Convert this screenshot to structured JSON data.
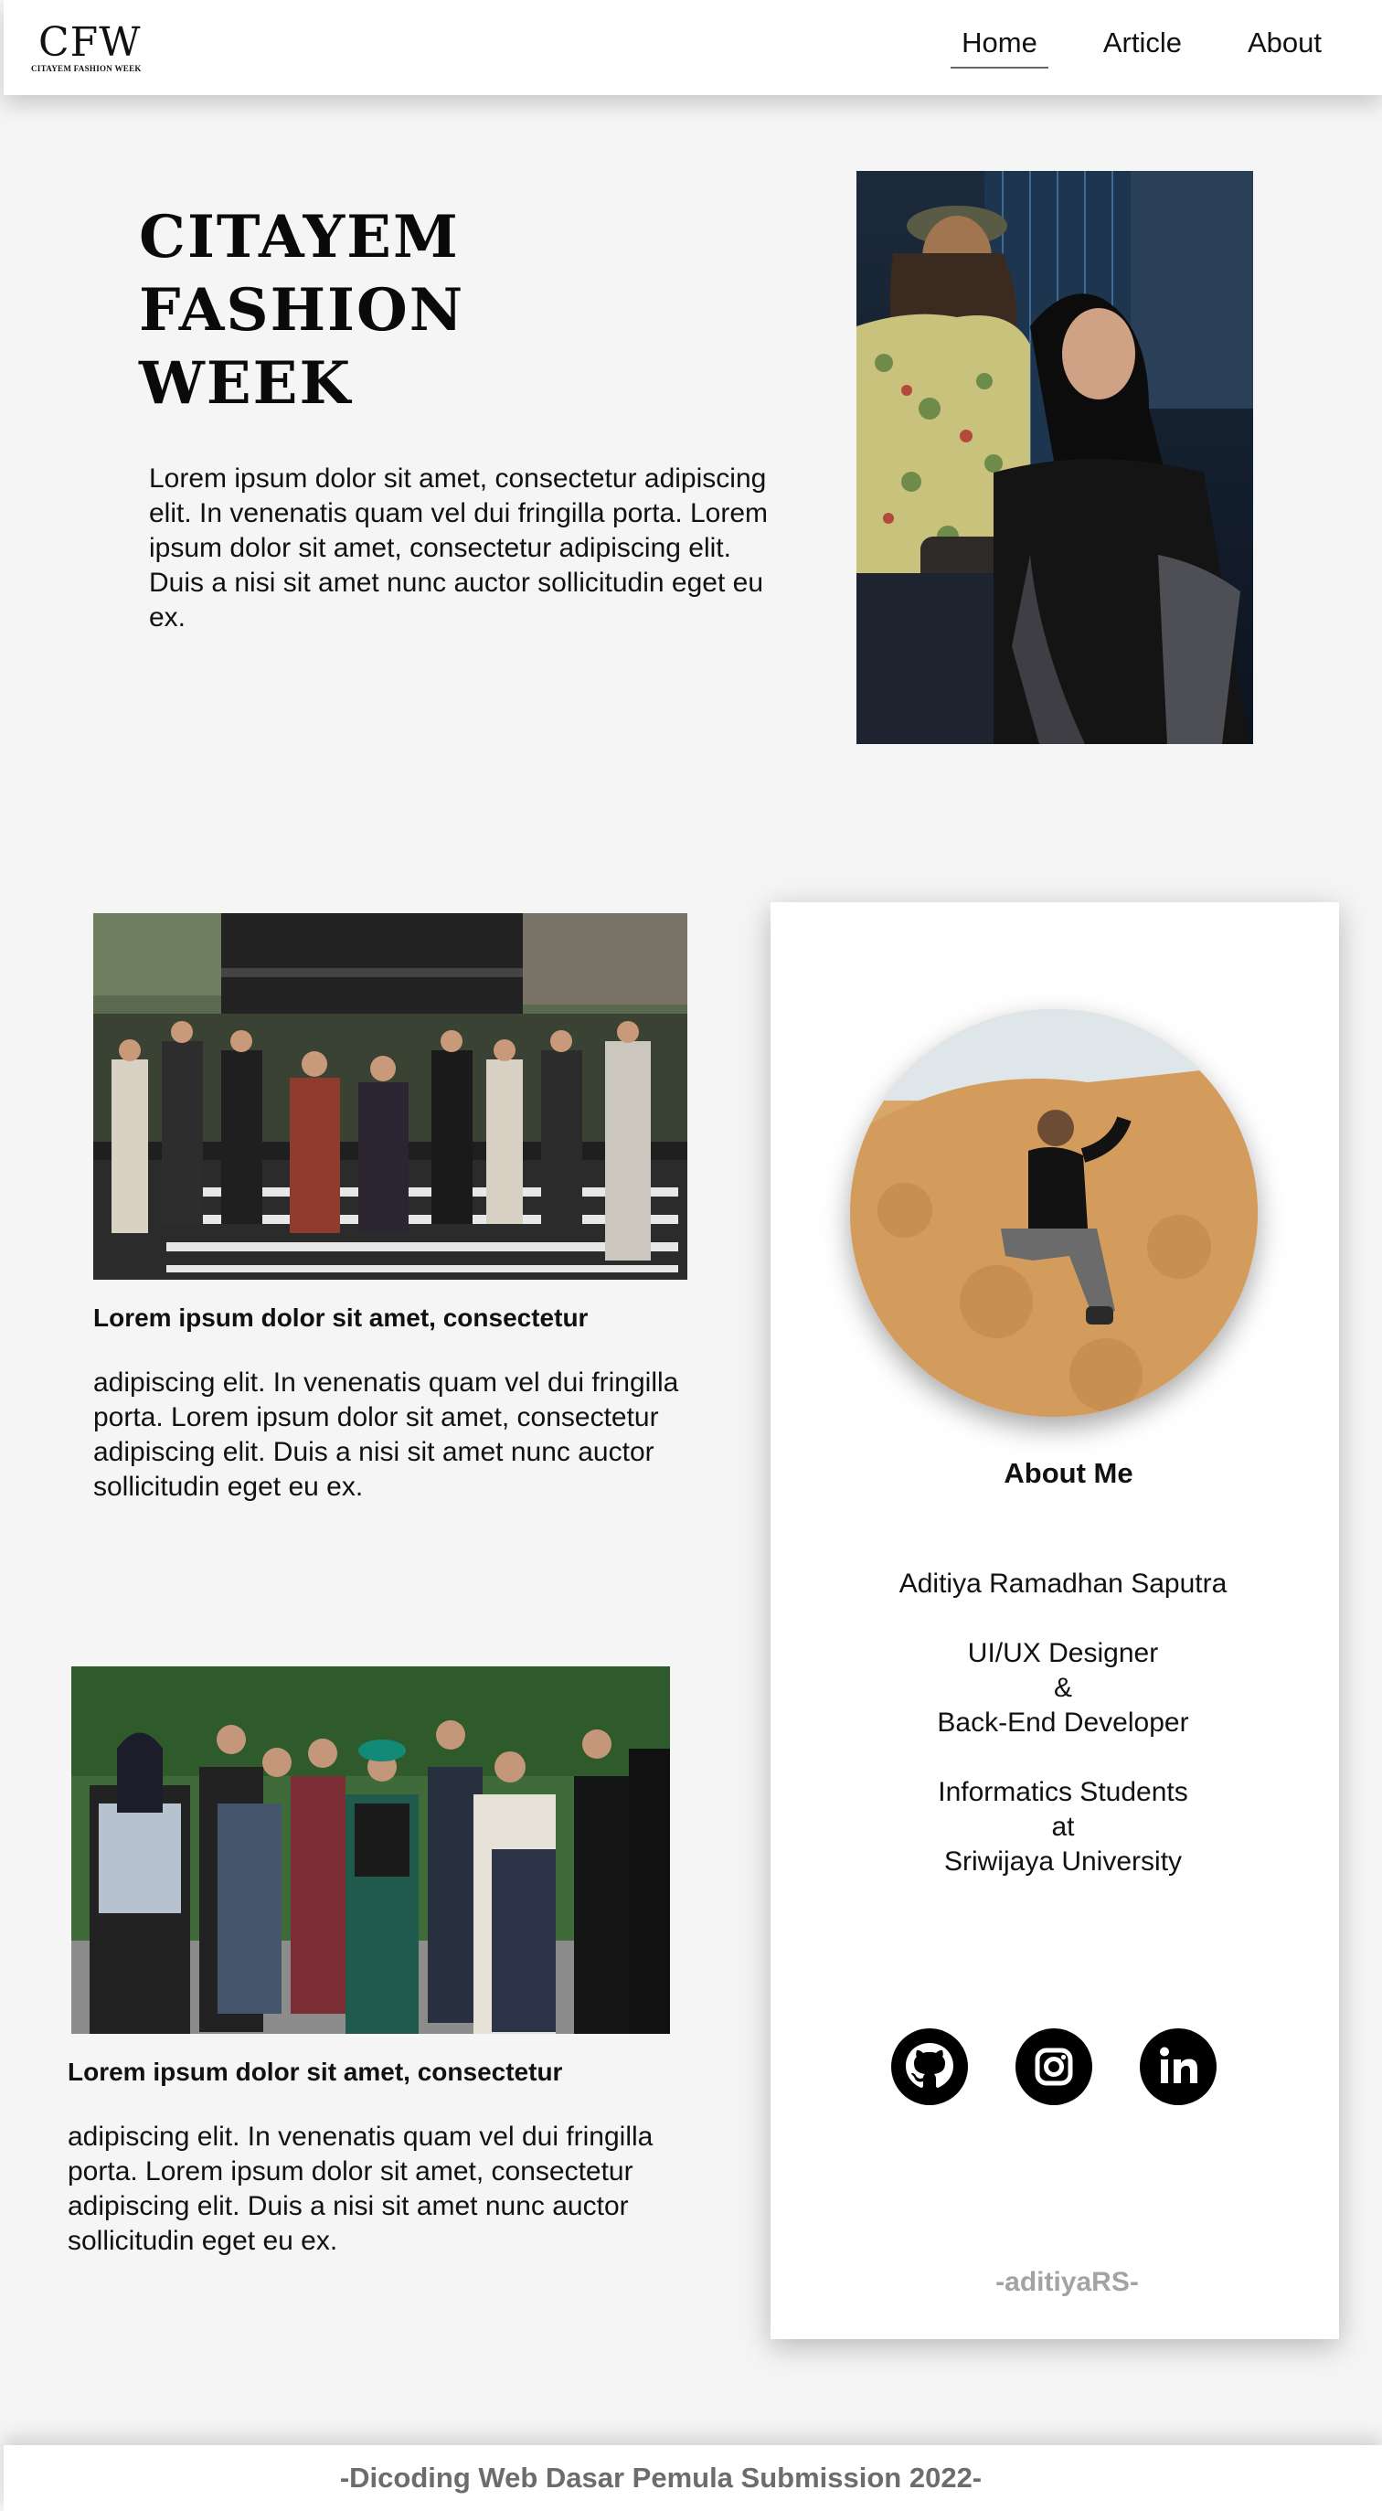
{
  "header": {
    "logo_main": "CFW",
    "logo_sub": "CITAYEM FASHION WEEK",
    "nav": [
      {
        "label": "Home",
        "active": true
      },
      {
        "label": "Article",
        "active": false
      },
      {
        "label": "About",
        "active": false
      }
    ]
  },
  "hero": {
    "title_lines": [
      "CITAYEM",
      "FASHION",
      "WEEK"
    ],
    "text": "Lorem ipsum dolor sit amet, consectetur adipiscing elit. In venenatis quam vel dui fringilla porta. Lorem ipsum dolor sit amet, consectetur adipiscing elit. Duis a nisi sit amet nunc auctor sollicitudin eget eu ex."
  },
  "articles": [
    {
      "heading": "Lorem ipsum dolor sit amet, consectetur",
      "text": "adipiscing elit. In venenatis quam vel dui fringilla porta. Lorem ipsum dolor sit amet, consectetur adipiscing elit. Duis a nisi sit amet nunc auctor sollicitudin eget eu ex."
    },
    {
      "heading": "Lorem ipsum dolor sit amet, consectetur",
      "text": "adipiscing elit. In venenatis quam vel dui fringilla porta. Lorem ipsum dolor sit amet, consectetur adipiscing elit. Duis a nisi sit amet nunc auctor sollicitudin eget eu ex."
    }
  ],
  "profile": {
    "title": "About Me",
    "name": "Aditiya Ramadhan Saputra",
    "role_lines": [
      "UI/UX Designer",
      "&",
      "Back-End Developer"
    ],
    "study_lines": [
      "Informatics Students",
      "at",
      "Sriwijaya University"
    ],
    "socials": [
      "github-icon",
      "instagram-icon",
      "linkedin-icon"
    ],
    "handle": "-aditiyaRS-"
  },
  "footer": {
    "text": "-Dicoding Web Dasar Pemula Submission 2022-"
  },
  "colors": {
    "background": "#f5f5f5",
    "card": "#ffffff",
    "text": "#111111",
    "muted": "#a3a3a3",
    "footer_text": "#6c6c6c"
  }
}
